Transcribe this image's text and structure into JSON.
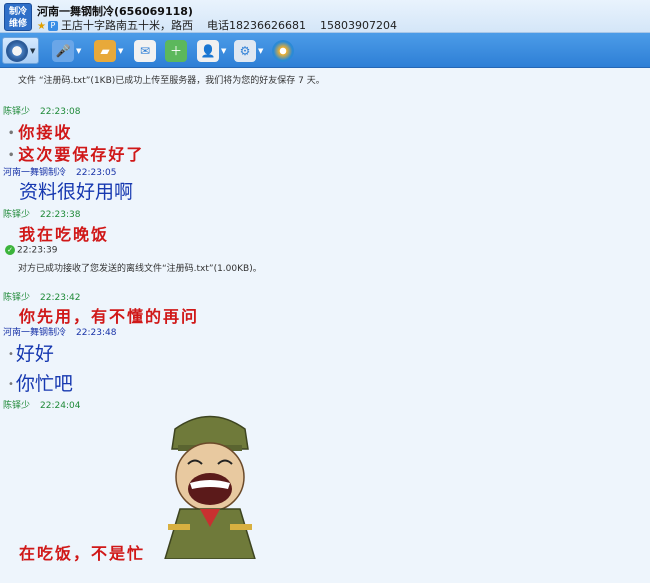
{
  "header": {
    "avatar_text": "制冷\n维修",
    "title": "河南一舞钢制冷(656069118)",
    "status": "王店十字路南五十米，路西",
    "phone": "电话18236626681",
    "phone2": "15803907204"
  },
  "toolbar": {
    "buttons": [
      "video-chat",
      "voice-chat",
      "send-file",
      "send-email",
      "create-group",
      "remote-assist",
      "settings",
      "app"
    ]
  },
  "chat": {
    "system_upload": "文件 “注册码.txt”(1KB)已成功上传至服务器，我们将为您的好友保存 7 天。",
    "messages": [
      {
        "sender": "陈铎少",
        "time": "22:23:08"
      },
      {
        "text": "你接收"
      },
      {
        "text": "这次要保存好了"
      },
      {
        "sender": "河南一舞钢制冷",
        "time": "22:23:05"
      },
      {
        "text": "资料很好用啊"
      },
      {
        "sender": "陈铎少",
        "time": "22:23:38"
      },
      {
        "text": "我在吃晚饭"
      },
      {
        "time": "22:23:39"
      },
      {
        "text": "对方已成功接收了您发送的离线文件“注册码.txt”(1.00KB)。"
      },
      {
        "sender": "陈铎少",
        "time": "22:23:42"
      },
      {
        "text": "你先用，有不懂的再问"
      },
      {
        "sender": "河南一舞钢制冷",
        "time": "22:23:48"
      },
      {
        "text": "好好"
      },
      {
        "text": "你忙吧"
      },
      {
        "sender": "陈铎少",
        "time": "22:24:04"
      },
      {
        "text": "在吃饭，不是忙"
      }
    ]
  },
  "colors": {
    "accent": "#2e7fd6",
    "red_text": "#d01818",
    "blue_text": "#1638b0",
    "green_name": "#1f8a38"
  }
}
